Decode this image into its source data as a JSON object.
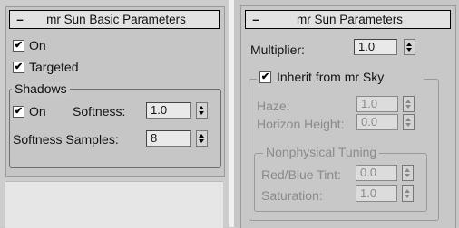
{
  "left": {
    "title": "mr Sun Basic Parameters",
    "on_label": "On",
    "targeted_label": "Targeted",
    "shadows_group": "Shadows",
    "shadows_on_label": "On",
    "softness_label": "Softness:",
    "softness_value": "1.0",
    "softness_samples_label": "Softness Samples:",
    "softness_samples_value": "8"
  },
  "right": {
    "title": "mr Sun Parameters",
    "multiplier_label": "Multiplier:",
    "multiplier_value": "1.0",
    "inherit_label": "Inherit from mr Sky",
    "haze_label": "Haze:",
    "haze_value": "1.0",
    "horizon_label": "Horizon Height:",
    "horizon_value": "0.0",
    "nonphysical_group": "Nonphysical Tuning",
    "redblue_label": "Red/Blue Tint:",
    "redblue_value": "0.0",
    "saturation_label": "Saturation:",
    "saturation_value": "1.0"
  },
  "checkmark": "✔"
}
